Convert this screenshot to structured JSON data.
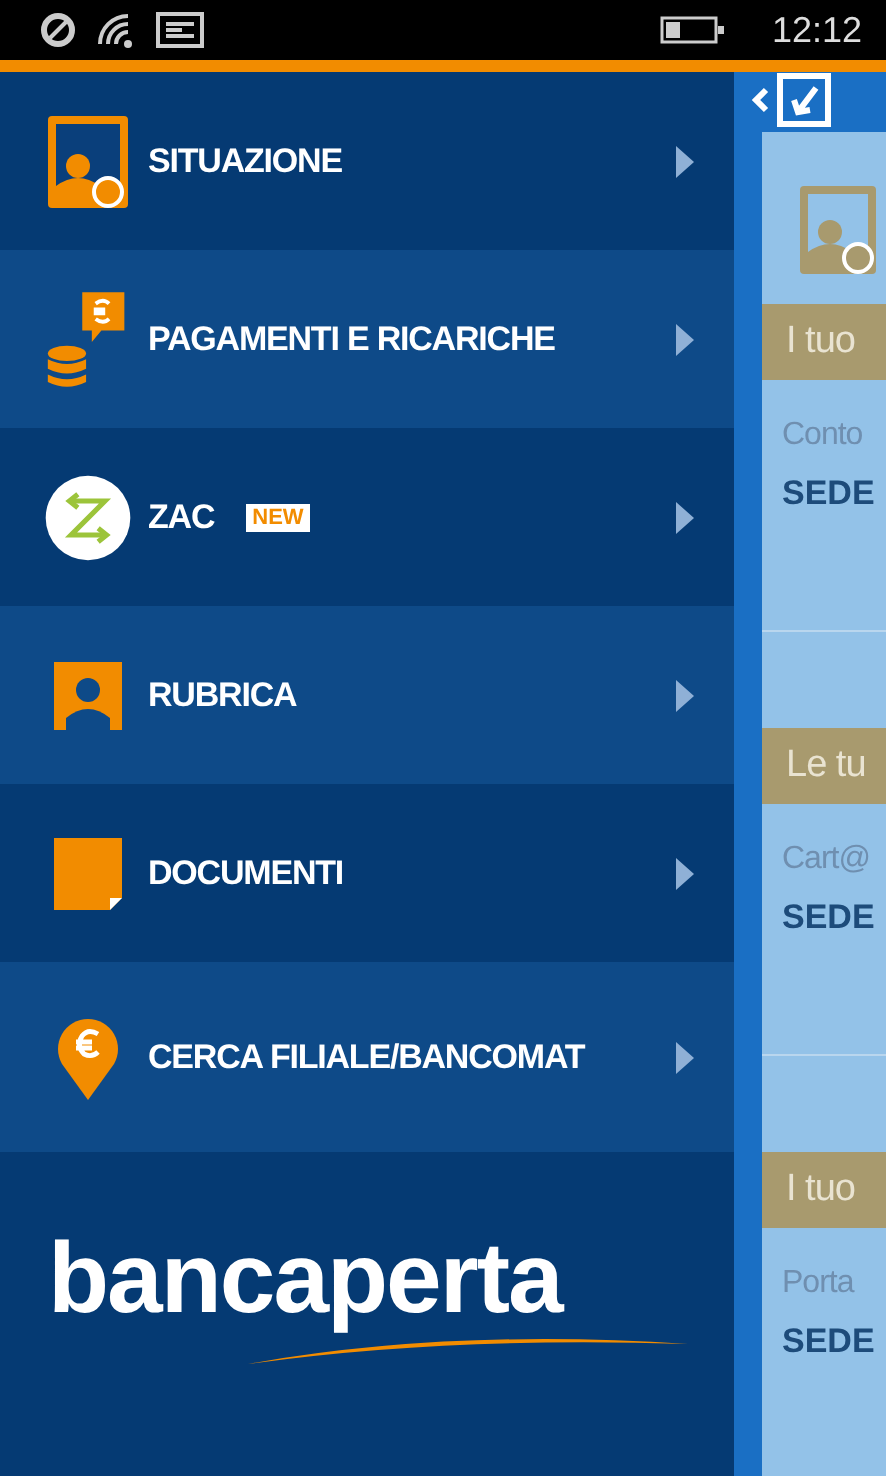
{
  "status_bar": {
    "time": "12:12"
  },
  "menu": [
    {
      "kind": "account",
      "label": "SITUAZIONE"
    },
    {
      "kind": "payments",
      "label": "PAGAMENTI E RICARICHE"
    },
    {
      "kind": "zac",
      "label": "ZAC",
      "badge": "NEW"
    },
    {
      "kind": "contacts",
      "label": "RUBRICA"
    },
    {
      "kind": "documents",
      "label": "DOCUMENTI"
    },
    {
      "kind": "locator",
      "label": "CERCA FILIALE/BANCOMAT"
    }
  ],
  "logo": {
    "text": "bancaperta"
  },
  "side_panel": {
    "sections": [
      {
        "header": "I tuo",
        "label": "Conto",
        "value": "SEDE"
      },
      {
        "header": "Le tu",
        "label": "Cart@",
        "value": "SEDE"
      },
      {
        "header": "I tuo",
        "label": "Porta",
        "value": "SEDE"
      }
    ]
  }
}
